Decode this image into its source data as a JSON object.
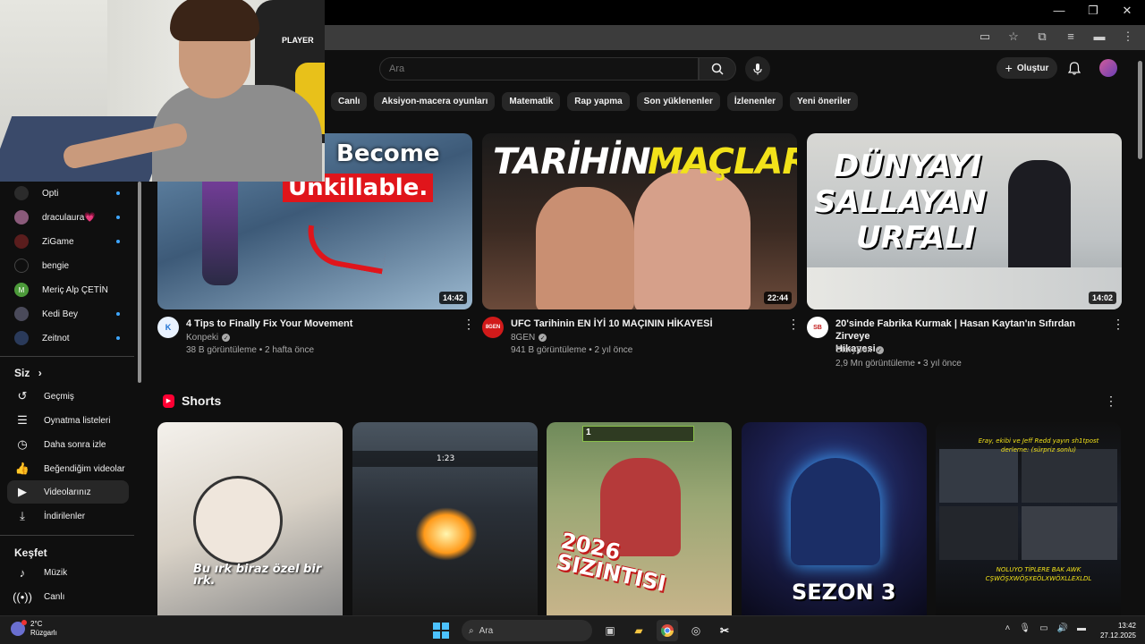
{
  "browser": {
    "window_controls": [
      "—",
      "❐",
      "✕"
    ],
    "address_icons": [
      "cast-icon",
      "star-icon",
      "extensions-icon",
      "media-icon",
      "profile-icon",
      "menu-icon"
    ]
  },
  "webcam": {
    "chair_brand": "PLAYER"
  },
  "header": {
    "search_placeholder": "Ara",
    "create_label": "Oluştur"
  },
  "chips": [
    "Canlı",
    "Aksiyon-macera oyunları",
    "Matematik",
    "Rap yapma",
    "Son yüklenenler",
    "İzlenenler",
    "Yeni öneriler"
  ],
  "subscriptions": [
    {
      "label": "Opti",
      "live": true,
      "avatar_color": "#2b2b2b"
    },
    {
      "label": "draculaura💗",
      "live": true,
      "avatar_color": "#8a5a7a"
    },
    {
      "label": "ZiGame",
      "live": true,
      "avatar_color": "#5a1d1d"
    },
    {
      "label": "bengie",
      "live": false,
      "avatar_color": "#0f0f0f"
    },
    {
      "label": "Meriç Alp ÇETİN",
      "live": false,
      "avatar_color": "#4c9a3a",
      "initial": "M"
    },
    {
      "label": "Kedi Bey",
      "live": true,
      "avatar_color": "#4a4a5a"
    },
    {
      "label": "Zeitnot",
      "live": true,
      "avatar_color": "#2a3a5a"
    }
  ],
  "you_section": {
    "heading": "Siz",
    "items": [
      {
        "label": "Geçmiş",
        "icon": "history-icon"
      },
      {
        "label": "Oynatma listeleri",
        "icon": "playlists-icon"
      },
      {
        "label": "Daha sonra izle",
        "icon": "watch-later-icon"
      },
      {
        "label": "Beğendiğim videolar",
        "icon": "like-icon"
      },
      {
        "label": "Videolarınız",
        "icon": "your-videos-icon",
        "active": true
      },
      {
        "label": "İndirilenler",
        "icon": "download-icon"
      }
    ]
  },
  "explore_section": {
    "heading": "Keşfet",
    "items": [
      {
        "label": "Müzik",
        "icon": "music-icon"
      },
      {
        "label": "Canlı",
        "icon": "live-icon"
      }
    ]
  },
  "videos": [
    {
      "thumb_text": [
        "Become",
        "Unkillable."
      ],
      "duration": "14:42",
      "title": "4 Tips to Finally Fix Your Movement",
      "channel": "Konpeki",
      "meta": "38 B görüntüleme • 2 hafta önce",
      "avatar_text": "K"
    },
    {
      "thumb_text": [
        "TARİHİN",
        "MAÇLARI"
      ],
      "duration": "22:44",
      "title": "UFC Tarihinin EN İYİ 10 MAÇININ HİKAYESİ",
      "channel": "8GEN",
      "meta": "941 B görüntüleme • 2 yıl önce",
      "avatar_text": "8GEN"
    },
    {
      "thumb_text": [
        "DÜNYAYI",
        "SALLAYAN",
        "URFALI"
      ],
      "duration": "14:02",
      "title_lines": [
        "20'sinde Fabrika Kurmak | Hasan Kaytan'ın Sıfırdan Zirveye",
        "Hikayesi"
      ],
      "channel": "StoryBox",
      "meta": "2,9 Mn görüntüleme • 3 yıl önce",
      "avatar_text": "SB"
    }
  ],
  "shorts": {
    "title": "Shorts",
    "items": [
      {
        "caption": "Bu ırk biraz özel bir ırk."
      },
      {
        "caption": "1:23"
      },
      {
        "caption": "2026 SIZINTISI",
        "badge": "1"
      },
      {
        "caption": "SEZON 3"
      },
      {
        "caption_top": "Eray, ekibi ve Jeff Redd yayın sh1tpost derleme: (sürpriz sonlu)",
        "caption_bottom": "NOLUYO TİPLERE BAK AWK CŞWÖŞXWÖŞXEÖLXWÖXLLEXLDL"
      }
    ]
  },
  "taskbar": {
    "temperature": "2°C",
    "weather": "Rüzgarlı",
    "search_label": "Ara",
    "time": "13:42",
    "date": "27.12.2025"
  },
  "colors": {
    "background": "#0f0f0f",
    "chip": "#272727",
    "live_dot": "#3ea6ff",
    "shorts_red": "#ff0033"
  }
}
